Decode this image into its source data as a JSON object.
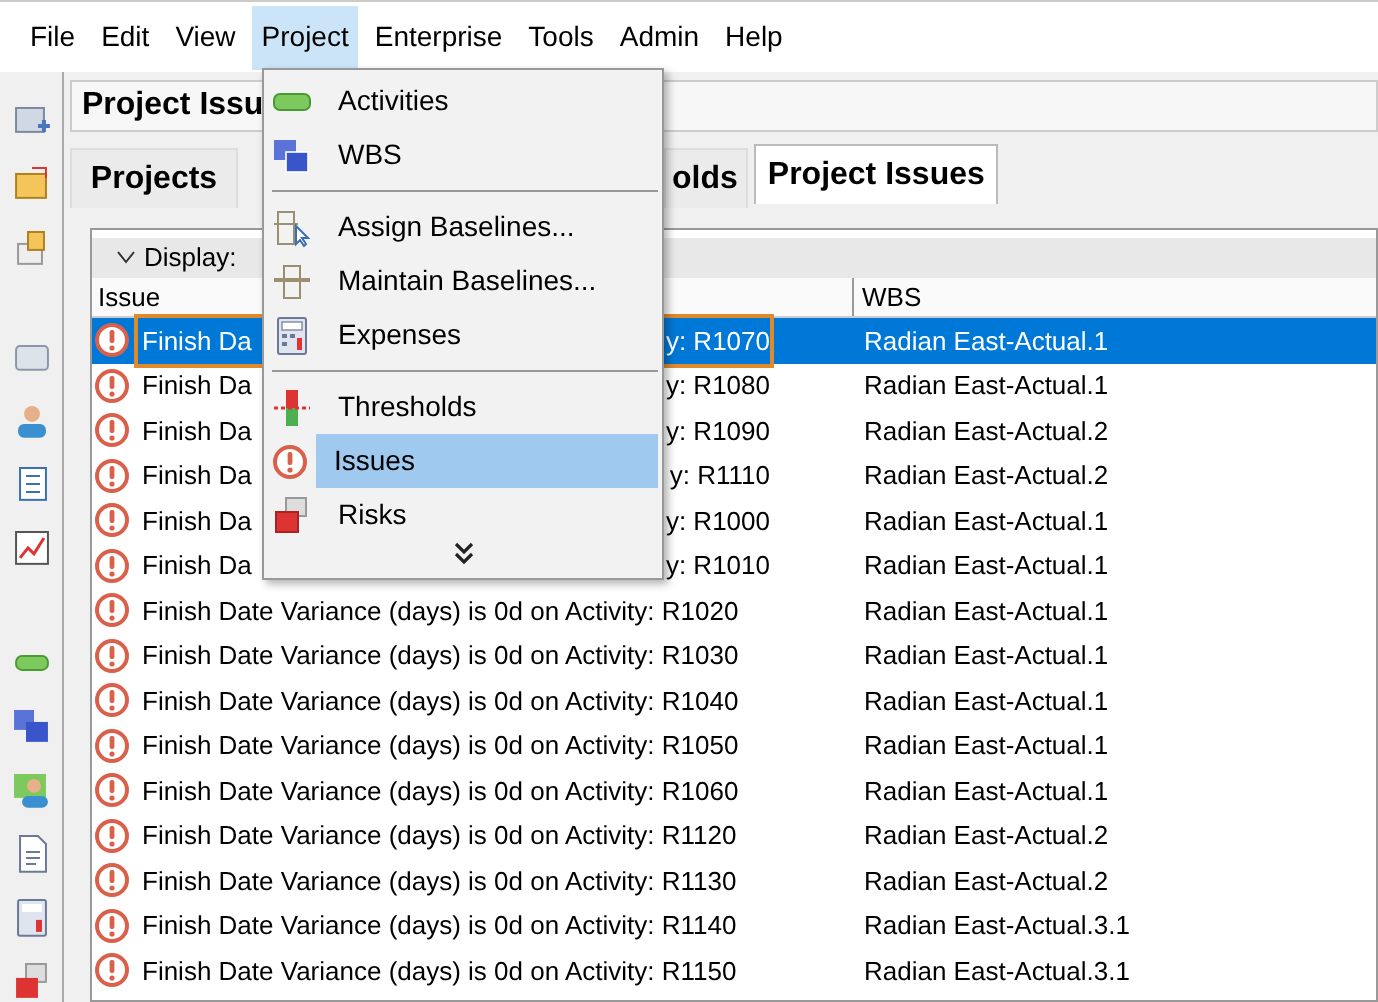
{
  "menu_bar": [
    {
      "label": "File",
      "selected": false
    },
    {
      "label": "Edit",
      "selected": false
    },
    {
      "label": "View",
      "selected": false
    },
    {
      "label": "Project",
      "selected": true
    },
    {
      "label": "Enterprise",
      "selected": false
    },
    {
      "label": "Tools",
      "selected": false
    },
    {
      "label": "Admin",
      "selected": false
    },
    {
      "label": "Help",
      "selected": false
    }
  ],
  "panel_title": "Project Issu",
  "tabs": [
    {
      "label": "Projects",
      "selected": false
    },
    {
      "label": "olds",
      "selected": false
    },
    {
      "label": "Project Issues",
      "selected": true
    }
  ],
  "display_label": "Display:",
  "table": {
    "columns": [
      "Issue",
      "WBS"
    ],
    "rows": [
      {
        "issue_parts": [
          "Finish Da",
          "y: R1070"
        ],
        "wbs": "Radian East-Actual.1",
        "selected": true
      },
      {
        "issue_parts": [
          "Finish Da",
          "y: R1080"
        ],
        "wbs": "Radian East-Actual.1",
        "selected": false
      },
      {
        "issue_parts": [
          "Finish Da",
          "y: R1090"
        ],
        "wbs": "Radian East-Actual.2",
        "selected": false
      },
      {
        "issue_parts": [
          "Finish Da",
          "y: R1110"
        ],
        "wbs": "Radian East-Actual.2",
        "selected": false
      },
      {
        "issue_parts": [
          "Finish Da",
          "y: R1000"
        ],
        "wbs": "Radian East-Actual.1",
        "selected": false
      },
      {
        "issue_parts": [
          "Finish Da",
          "y: R1010"
        ],
        "wbs": "Radian East-Actual.1",
        "selected": false
      },
      {
        "issue_parts": [
          "Finish Date Variance (days) is 0d on Activity: R1020"
        ],
        "wbs": "Radian East-Actual.1",
        "selected": false
      },
      {
        "issue_parts": [
          "Finish Date Variance (days) is 0d on Activity: R1030"
        ],
        "wbs": "Radian East-Actual.1",
        "selected": false
      },
      {
        "issue_parts": [
          "Finish Date Variance (days) is 0d on Activity: R1040"
        ],
        "wbs": "Radian East-Actual.1",
        "selected": false
      },
      {
        "issue_parts": [
          "Finish Date Variance (days) is 0d on Activity: R1050"
        ],
        "wbs": "Radian East-Actual.1",
        "selected": false
      },
      {
        "issue_parts": [
          "Finish Date Variance (days) is 0d on Activity: R1060"
        ],
        "wbs": "Radian East-Actual.1",
        "selected": false
      },
      {
        "issue_parts": [
          "Finish Date Variance (days) is 0d on Activity: R1120"
        ],
        "wbs": "Radian East-Actual.2",
        "selected": false
      },
      {
        "issue_parts": [
          "Finish Date Variance (days) is 0d on Activity: R1130"
        ],
        "wbs": "Radian East-Actual.2",
        "selected": false
      },
      {
        "issue_parts": [
          "Finish Date Variance (days) is 0d on Activity: R1140"
        ],
        "wbs": "Radian East-Actual.3.1",
        "selected": false
      },
      {
        "issue_parts": [
          "Finish Date Variance (days) is 0d on Activity: R1150"
        ],
        "wbs": "Radian East-Actual.3.1",
        "selected": false
      }
    ]
  },
  "project_menu": [
    {
      "kind": "item",
      "label": "Activities",
      "selected": false
    },
    {
      "kind": "item",
      "label": "WBS",
      "selected": false
    },
    {
      "kind": "separator"
    },
    {
      "kind": "item",
      "label": "Assign Baselines...",
      "selected": false
    },
    {
      "kind": "item",
      "label": "Maintain Baselines...",
      "selected": false
    },
    {
      "kind": "item",
      "label": "Expenses",
      "selected": false
    },
    {
      "kind": "separator"
    },
    {
      "kind": "item",
      "label": "Thresholds",
      "selected": false
    },
    {
      "kind": "item",
      "label": "Issues",
      "selected": true
    },
    {
      "kind": "item",
      "label": "Risks",
      "selected": false
    },
    {
      "kind": "more"
    }
  ]
}
